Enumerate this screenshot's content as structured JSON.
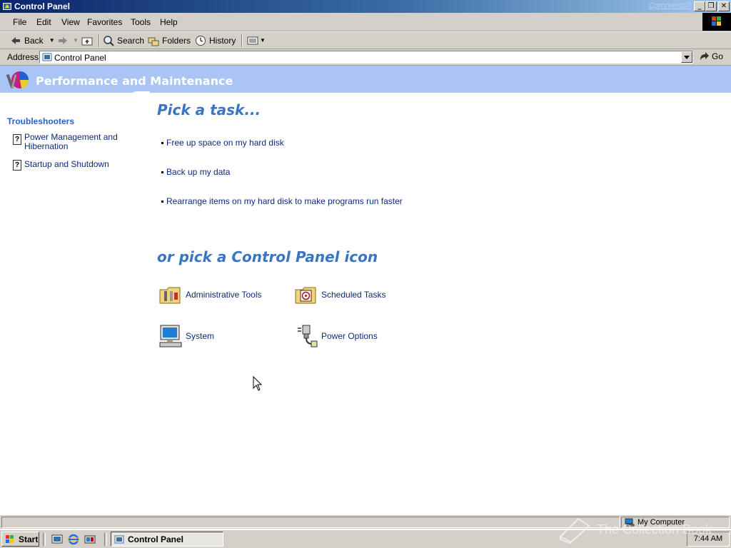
{
  "window": {
    "title": "Control Panel",
    "comments_link": "Comments?",
    "minimize_glyph": "_",
    "restore_glyph": "❐",
    "close_glyph": "✕"
  },
  "menu": [
    "File",
    "Edit",
    "View",
    "Favorites",
    "Tools",
    "Help"
  ],
  "toolbar": {
    "back": "Back",
    "search": "Search",
    "folders": "Folders",
    "history": "History"
  },
  "address": {
    "label": "Address",
    "value": "Control Panel",
    "go": "Go"
  },
  "banner": {
    "title": "Performance and Maintenance"
  },
  "sidebar": {
    "section_title": "Troubleshooters",
    "items": [
      {
        "label_line1": "Power Management and",
        "label_line2": "Hibernation",
        "icon": "help-icon"
      },
      {
        "label_line1": "Startup and Shutdown",
        "label_line2": "",
        "icon": "help-icon"
      }
    ]
  },
  "main": {
    "pick_task_title": "Pick a task...",
    "tasks": [
      "Free up space on my hard disk",
      "Back up my data",
      "Rearrange items on my hard disk to make programs run faster"
    ],
    "pick_icon_title": "or pick a Control Panel icon",
    "icons": [
      {
        "label": "Administrative Tools",
        "icon": "administrative-tools-icon"
      },
      {
        "label": "Scheduled Tasks",
        "icon": "scheduled-tasks-icon"
      },
      {
        "label": "System",
        "icon": "system-icon"
      },
      {
        "label": "Power Options",
        "icon": "power-options-icon"
      }
    ]
  },
  "statusbar": {
    "zone": "My Computer"
  },
  "taskbar": {
    "start": "Start",
    "active_window": "Control Panel",
    "clock": "7:44 AM"
  },
  "watermark": "The Collection Book",
  "colors": {
    "banner": "#a9c4f5",
    "heading_blue": "#3a75c4",
    "link_blue": "#0b2b78",
    "chrome_gray": "#d4d0c8",
    "title_dark": "#0a246a"
  }
}
